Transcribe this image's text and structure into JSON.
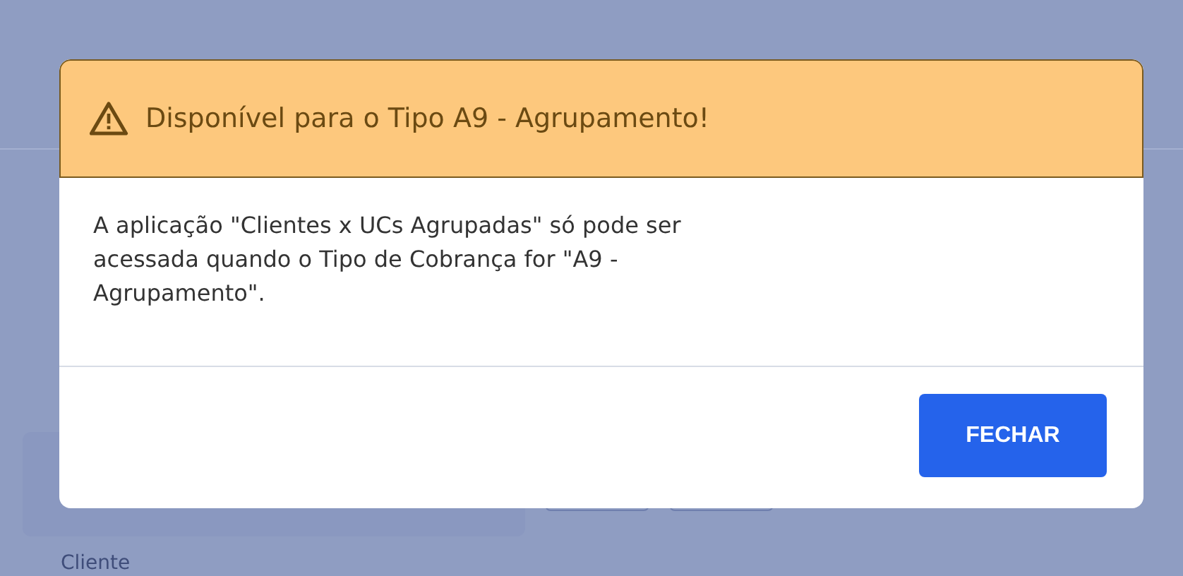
{
  "background": {
    "field_label": "Cliente"
  },
  "dialog": {
    "title": "Disponível para o Tipo A9 - Agrupamento!",
    "message": "A aplicação \"Clientes x UCs Agrupadas\" só pode ser acessada quando o Tipo de Cobrança for \"A9 - Agrupamento\".",
    "buttons": [
      "FECHAR"
    ]
  }
}
